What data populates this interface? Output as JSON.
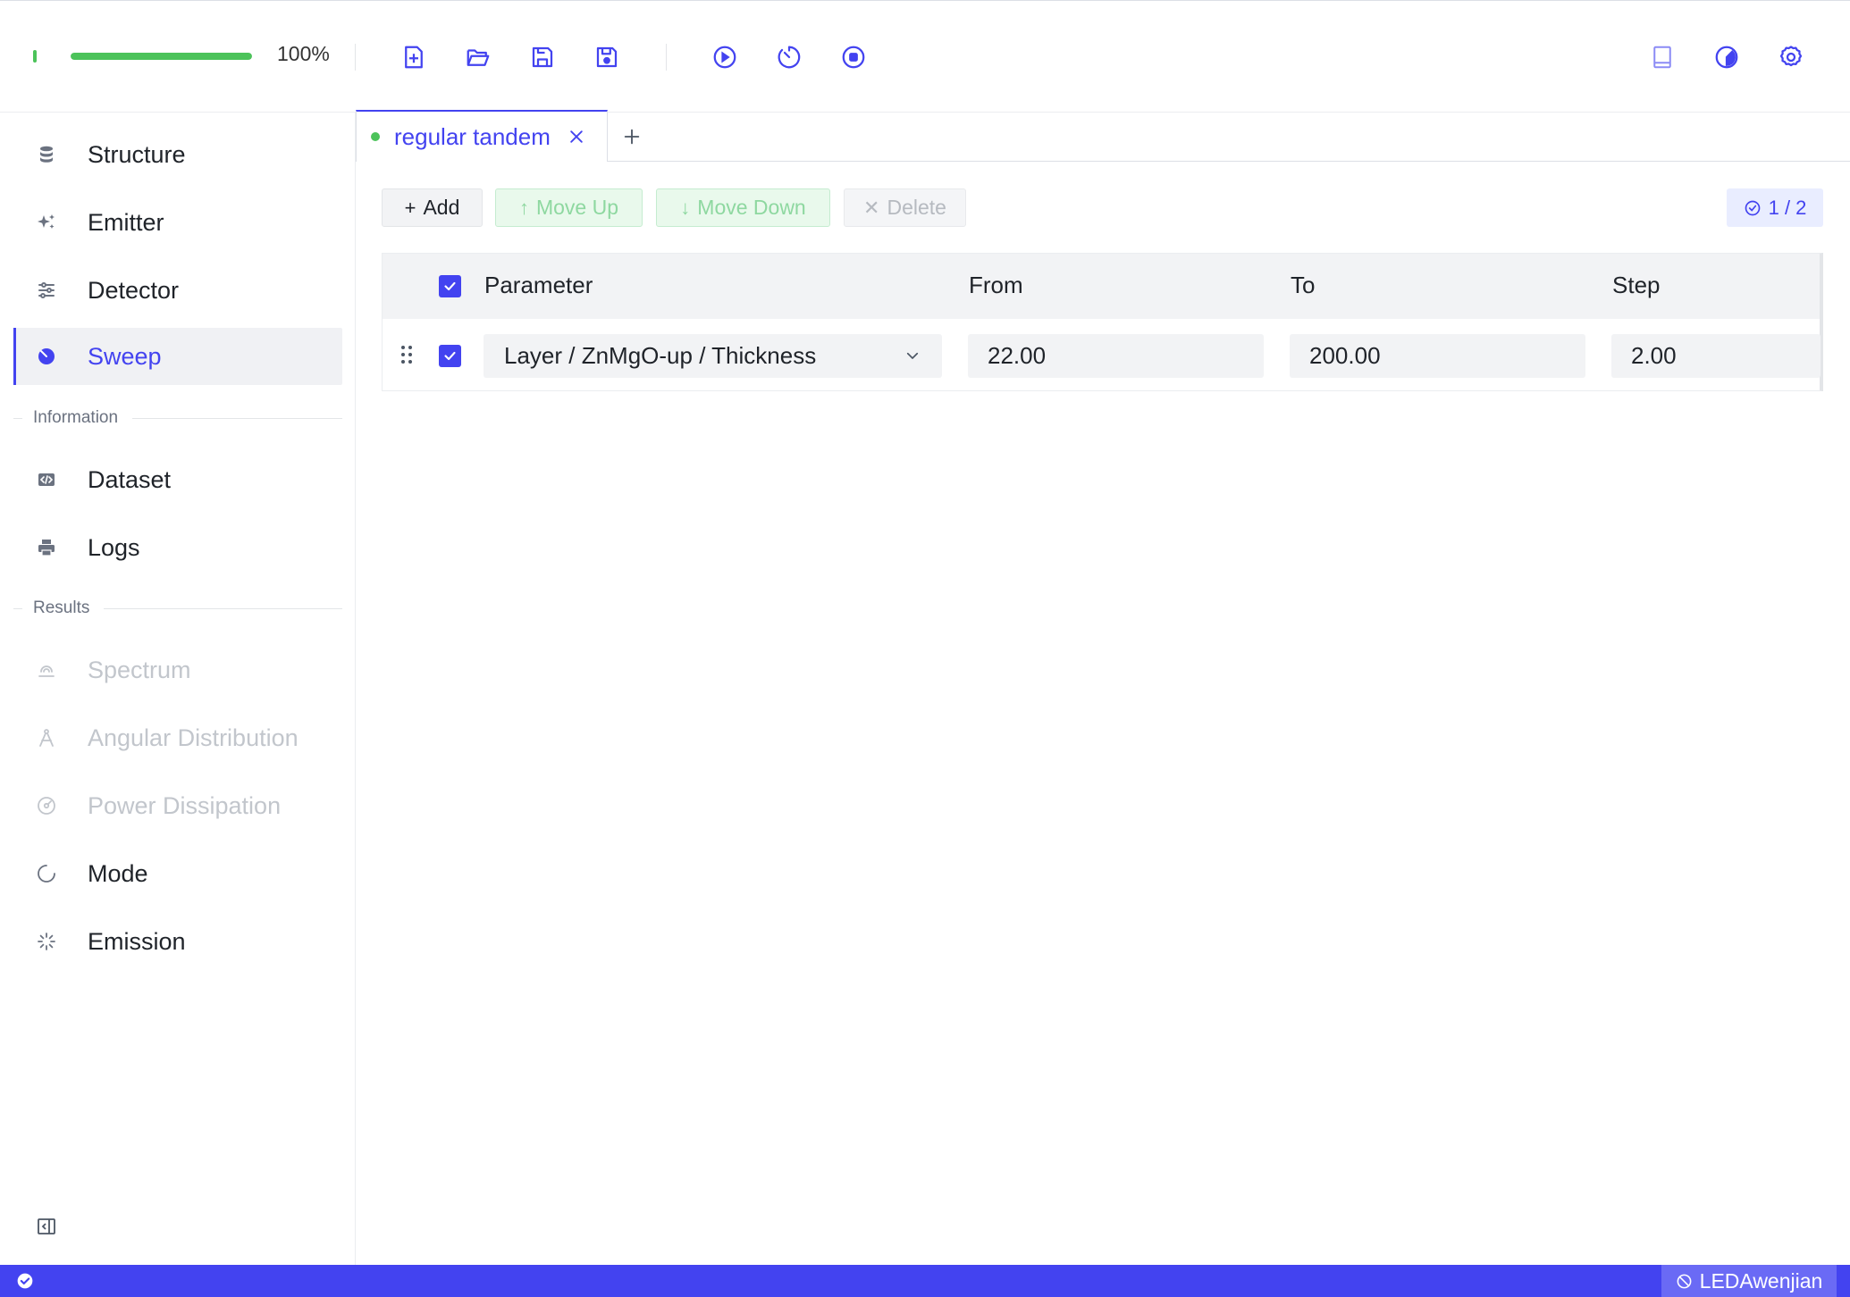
{
  "toolbar": {
    "progress_percent": 100,
    "progress_label": "100%",
    "icons": [
      "new-file-icon",
      "open-folder-icon",
      "save-icon",
      "save-as-icon",
      "run-icon",
      "timer-icon",
      "stop-icon",
      "book-icon",
      "theme-icon",
      "settings-icon"
    ]
  },
  "colors": {
    "accent": "#4343f0",
    "success": "#4cc35a",
    "status_bar": "#4343f0",
    "disabled_text": "#c2c6cc"
  },
  "sidebar": {
    "items": [
      {
        "label": "Structure",
        "icon": "database-icon"
      },
      {
        "label": "Emitter",
        "icon": "sparkle-icon"
      },
      {
        "label": "Detector",
        "icon": "sliders-icon"
      },
      {
        "label": "Sweep",
        "icon": "sweep-icon",
        "active": true
      }
    ],
    "information_title": "Information",
    "information_items": [
      {
        "label": "Dataset",
        "icon": "code-file-icon"
      },
      {
        "label": "Logs",
        "icon": "printer-icon"
      }
    ],
    "results_title": "Results",
    "results_items": [
      {
        "label": "Spectrum",
        "icon": "spectrum-icon",
        "disabled": true
      },
      {
        "label": "Angular Distribution",
        "icon": "compass-icon",
        "disabled": true
      },
      {
        "label": "Power Dissipation",
        "icon": "gauge-icon",
        "disabled": true
      },
      {
        "label": "Mode",
        "icon": "circle-loading-icon"
      },
      {
        "label": "Emission",
        "icon": "burst-icon"
      }
    ]
  },
  "tabs": [
    {
      "label": "regular tandem",
      "active": true
    }
  ],
  "actions": {
    "add": "Add",
    "move_up": "Move Up",
    "move_down": "Move Down",
    "delete": "Delete",
    "selection_count": "1 / 2"
  },
  "table": {
    "headers": [
      "Parameter",
      "From",
      "To",
      "Step"
    ],
    "rows": [
      {
        "checked": true,
        "parameter": "Layer / ZnMgO-up / Thickness",
        "from": "22.00",
        "to": "200.00",
        "step": "2.00"
      }
    ]
  },
  "status": {
    "user": "LEDAwenjian"
  }
}
